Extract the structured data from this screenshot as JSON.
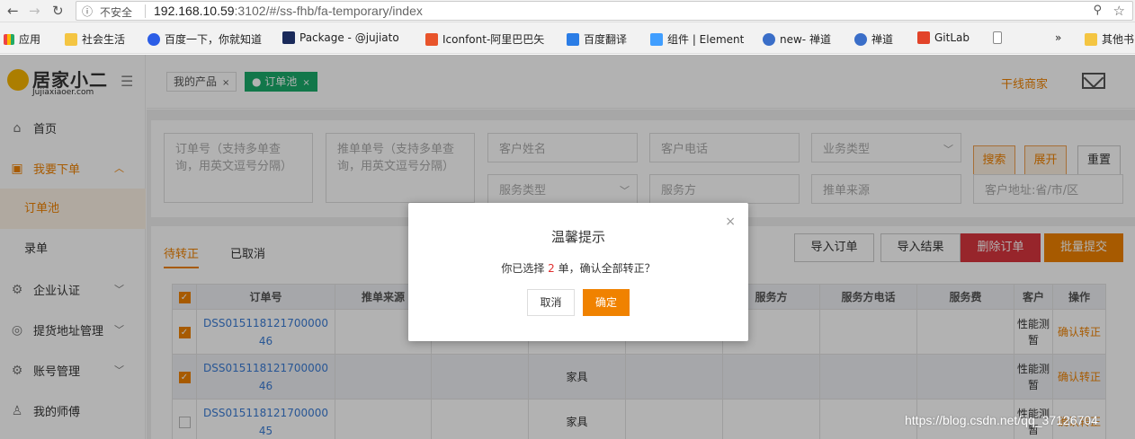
{
  "browser": {
    "insecure_label": "不安全",
    "url_host": "192.168.10.59",
    "url_path": ":3102/#/ss-fhb/fa-temporary/index",
    "bookmarks": [
      "应用",
      "社会生活",
      "百度一下，你就知道",
      "Package - @jujiato",
      "Iconfont-阿里巴巴矢",
      "百度翻译",
      "组件 | Element",
      "new- 禅道",
      "禅道",
      "GitLab",
      "»",
      "其他书"
    ]
  },
  "sidebar": {
    "logo_main": "居家小二",
    "logo_sub": "Jujiaxiaoer.com",
    "items": [
      {
        "label": "首页"
      },
      {
        "label": "我要下单"
      },
      {
        "label": "订单池"
      },
      {
        "label": "录单"
      },
      {
        "label": "企业认证"
      },
      {
        "label": "提货地址管理"
      },
      {
        "label": "账号管理"
      },
      {
        "label": "我的师傅"
      }
    ]
  },
  "topbar": {
    "tabs": [
      {
        "label": "我的产品"
      },
      {
        "label": "订单池"
      }
    ],
    "merchant": "干线商家"
  },
  "search": {
    "order_no_placeholder": "订单号（支持多单查询，用英文逗号分隔）",
    "push_no_placeholder": "推单单号（支持多单查询，用英文逗号分隔）",
    "customer_name": "客户姓名",
    "customer_phone": "客户电话",
    "business_type": "业务类型",
    "service_type": "服务类型",
    "service_party": "服务方",
    "push_source": "推单来源",
    "customer_address": "客户地址:省/市/区",
    "search_btn": "搜索",
    "expand_btn": "展开",
    "reset_btn": "重置"
  },
  "list": {
    "tabs": [
      "待转正",
      "已取消"
    ],
    "actions": [
      "导入订单",
      "导入结果",
      "删除订单",
      "批量提交"
    ],
    "columns": [
      "订单号",
      "推单来源",
      "",
      "",
      "",
      "服务方",
      "服务方电话",
      "服务费",
      "客户",
      "操作"
    ],
    "rows": [
      {
        "checked": true,
        "order_no_line1": "DSS015118121700000",
        "order_no_line2": "46",
        "category": "",
        "customer": "性能测\n暂",
        "action": "确认转正"
      },
      {
        "checked": true,
        "order_no_line1": "DSS015118121700000",
        "order_no_line2": "46",
        "category": "家具",
        "customer": "性能测\n暂",
        "action": "确认转正"
      },
      {
        "checked": false,
        "order_no_line1": "DSS015118121700000",
        "order_no_line2": "45",
        "category": "家具",
        "customer": "性能测\n暂",
        "action": "确认转正"
      }
    ]
  },
  "modal": {
    "title": "温馨提示",
    "msg_prefix": "你已选择",
    "msg_count": "2",
    "msg_suffix": "单，确认全部转正？",
    "cancel": "取消",
    "ok": "确定"
  },
  "watermark": "https://blog.csdn.net/qq_37126704",
  "colors": {
    "accent": "#f08200",
    "tab_green": "#1aab6a",
    "danger": "#d9363e",
    "link": "#3a7bd5"
  }
}
